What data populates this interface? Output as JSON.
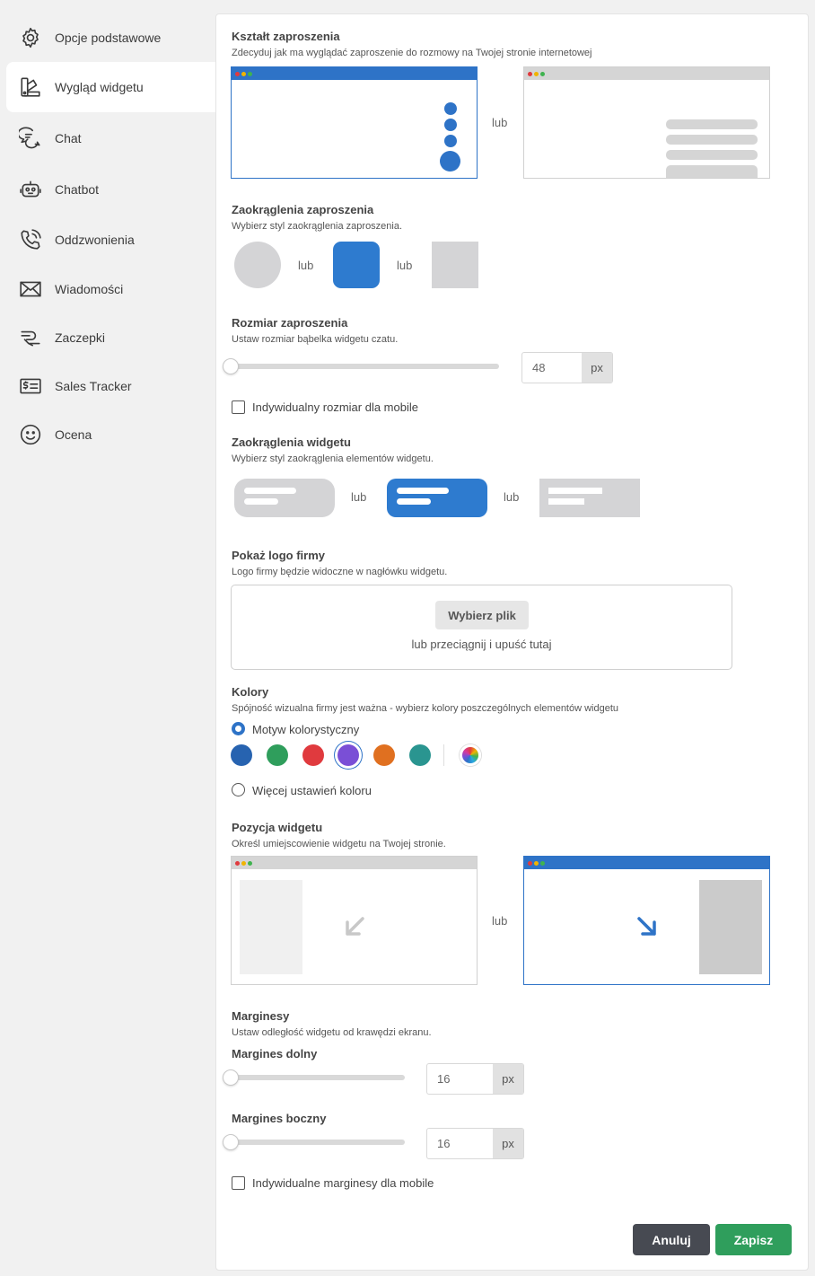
{
  "sidebar": {
    "items": [
      {
        "label": "Opcje podstawowe",
        "icon": "gear-icon"
      },
      {
        "label": "Wygląd widgetu",
        "icon": "palette-icon"
      },
      {
        "label": "Chat",
        "icon": "chat-bubbles-icon"
      },
      {
        "label": "Chatbot",
        "icon": "robot-icon"
      },
      {
        "label": "Oddzwonienia",
        "icon": "phone-callback-icon"
      },
      {
        "label": "Wiadomości",
        "icon": "envelope-icon"
      },
      {
        "label": "Zaczepki",
        "icon": "hook-icon"
      },
      {
        "label": "Sales Tracker",
        "icon": "dollar-ticket-icon"
      },
      {
        "label": "Ocena",
        "icon": "smiley-icon"
      }
    ],
    "active_index": 1
  },
  "invite_shape": {
    "title": "Kształt zaproszenia",
    "subtitle": "Zdecyduj jak ma wyglądać zaproszenie do rozmowy na Twojej stronie internetowej",
    "or": "lub"
  },
  "invite_rounding": {
    "title": "Zaokrąglenia zaproszenia",
    "subtitle": "Wybierz styl zaokrąglenia zaproszenia.",
    "or": "lub"
  },
  "invite_size": {
    "title": "Rozmiar zaproszenia",
    "subtitle": "Ustaw rozmiar bąbelka widgetu czatu.",
    "value": "48",
    "unit": "px",
    "mobile_label": "Indywidualny rozmiar dla mobile"
  },
  "widget_rounding": {
    "title": "Zaokrąglenia widgetu",
    "subtitle": "Wybierz styl zaokrąglenia elementów widgetu.",
    "or": "lub"
  },
  "logo": {
    "title": "Pokaż logo firmy",
    "subtitle": "Logo firmy będzie widoczne w nagłówku widgetu.",
    "button": "Wybierz plik",
    "drop_text": "lub przeciągnij i upuść tutaj"
  },
  "colors": {
    "title": "Kolory",
    "subtitle": "Spójność wizualna firmy jest ważna - wybierz kolory poszczególnych elementów widgetu",
    "theme_label": "Motyw kolorystyczny",
    "more_label": "Więcej ustawień koloru",
    "swatches": [
      "#2763b0",
      "#2f9e5c",
      "#e03a3e",
      "#7a4fd6",
      "#e07020",
      "#2a9590"
    ],
    "selected_index": 3
  },
  "position": {
    "title": "Pozycja widgetu",
    "subtitle": "Określ umiejscowienie widgetu na Twojej stronie.",
    "or": "lub"
  },
  "margins": {
    "title": "Marginesy",
    "subtitle": "Ustaw odległość widgetu od krawędzi ekranu.",
    "bottom_label": "Margines dolny",
    "bottom_value": "16",
    "side_label": "Margines boczny",
    "side_value": "16",
    "unit": "px",
    "mobile_label": "Indywidualne marginesy dla mobile"
  },
  "actions": {
    "cancel": "Anuluj",
    "save": "Zapisz",
    "cancel_color": "#474a52",
    "save_color": "#2f9e5c"
  },
  "accent": "#2e73c7"
}
